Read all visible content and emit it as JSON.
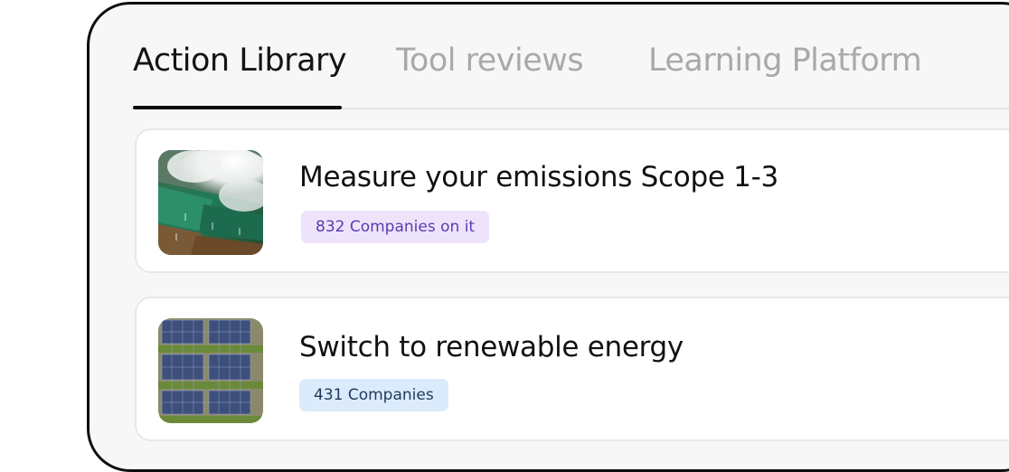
{
  "tabs": [
    {
      "label": "Action Library",
      "active": true
    },
    {
      "label": "Tool reviews",
      "active": false
    },
    {
      "label": "Learning Platform",
      "active": false
    }
  ],
  "actions": [
    {
      "title": "Measure your emissions Scope 1-3",
      "badge": "832 Companies on it",
      "badge_bg": "#ede4fb",
      "badge_fg": "#5b3bb0",
      "image": "aerial-wind-farm-image"
    },
    {
      "title": "Switch to renewable energy",
      "badge": "431 Companies",
      "badge_bg": "#dcebfb",
      "badge_fg": "#1e3a5c",
      "image": "solar-panels-image"
    }
  ],
  "colors": {
    "frame_border": "#0d0d0d",
    "panel_bg": "#f7f7f7",
    "tab_active": "#141414",
    "tab_inactive": "#a9a9a9"
  }
}
